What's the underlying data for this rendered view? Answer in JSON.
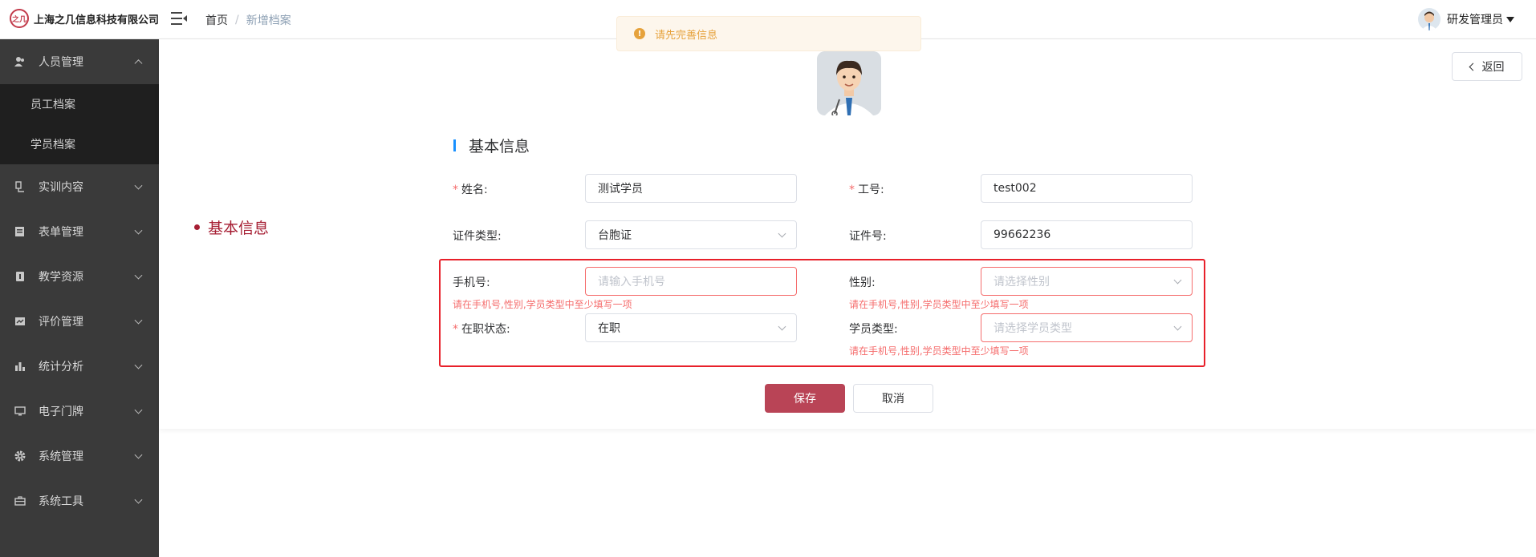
{
  "header": {
    "logo_mark": "之几",
    "company": "上海之几信息科技有限公司",
    "breadcrumb": {
      "home": "首页",
      "separator": "/",
      "current": "新增档案"
    },
    "toast": {
      "text": "请先完善信息",
      "icon": "warning-icon"
    },
    "user": {
      "name": "研发管理员"
    }
  },
  "sidebar": {
    "items": [
      {
        "label": "人员管理",
        "icon": "user-icon",
        "open": true,
        "children": [
          {
            "label": "员工档案"
          },
          {
            "label": "学员档案"
          }
        ]
      },
      {
        "label": "实训内容",
        "icon": "training-icon"
      },
      {
        "label": "表单管理",
        "icon": "form-icon"
      },
      {
        "label": "教学资源",
        "icon": "resource-icon"
      },
      {
        "label": "评价管理",
        "icon": "evaluation-icon"
      },
      {
        "label": "统计分析",
        "icon": "chart-icon"
      },
      {
        "label": "电子门牌",
        "icon": "display-icon"
      },
      {
        "label": "系统管理",
        "icon": "gear-icon"
      },
      {
        "label": "系统工具",
        "icon": "toolbox-icon"
      }
    ]
  },
  "main": {
    "back_label": "返回",
    "anchor_label": "基本信息",
    "section_title": "基本信息",
    "form": {
      "name": {
        "label": "姓名:",
        "value": "测试学员",
        "required": "*"
      },
      "job_no": {
        "label": "工号:",
        "value": "test002",
        "required": "*"
      },
      "id_type": {
        "label": "证件类型:",
        "value": "台胞证"
      },
      "id_no": {
        "label": "证件号:",
        "value": "99662236"
      },
      "phone": {
        "label": "手机号:",
        "placeholder": "请输入手机号",
        "error": "请在手机号,性别,学员类型中至少填写一项"
      },
      "gender": {
        "label": "性别:",
        "placeholder": "请选择性别",
        "error": "请在手机号,性别,学员类型中至少填写一项"
      },
      "status": {
        "label": "在职状态:",
        "value": "在职",
        "required": "*"
      },
      "student_type": {
        "label": "学员类型:",
        "placeholder": "请选择学员类型",
        "error": "请在手机号,性别,学员类型中至少填写一项"
      }
    },
    "save_label": "保存",
    "cancel_label": "取消"
  },
  "colors": {
    "primary": "#b94456",
    "sidebar_bg": "#3a3a3a",
    "error": "#f56c6c",
    "warning": "#e6a23c",
    "highlight": "#e8202a"
  }
}
